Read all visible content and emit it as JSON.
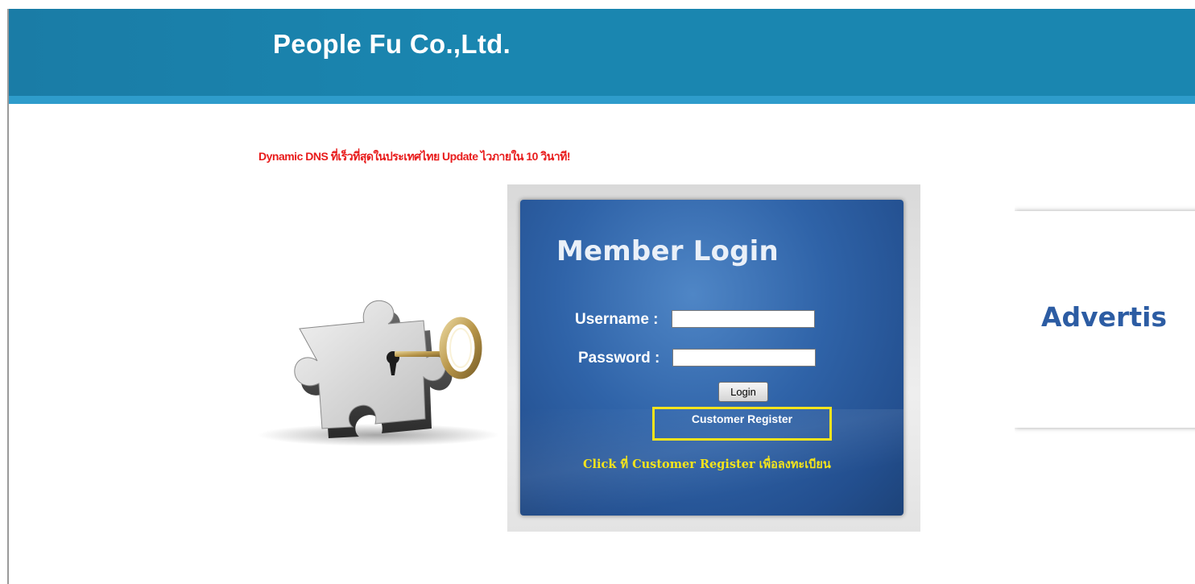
{
  "header": {
    "site_title": "People Fu Co.,Ltd."
  },
  "promo": {
    "text": "Dynamic DNS ที่เร็วที่สุดในประเทศไทย Update ไวภายใน 10 วินาที!"
  },
  "login": {
    "heading": "Member Login",
    "username_label": "Username :",
    "username_value": "",
    "password_label": "Password :",
    "password_value": "",
    "login_button": "Login",
    "register_link": "Customer Register",
    "register_hint": "Click ที่ Customer Register เพื่อลงทะเบียน"
  },
  "advertisement": {
    "text": "Advertis"
  },
  "colors": {
    "header_blue": "#1a86b0",
    "promo_red": "#e81b1b",
    "panel_blue": "#2f63a8",
    "highlight_yellow": "#f4e41c",
    "ad_text_blue": "#2c5ca3"
  },
  "icons": {
    "hero_art": "puzzle-key-icon"
  }
}
